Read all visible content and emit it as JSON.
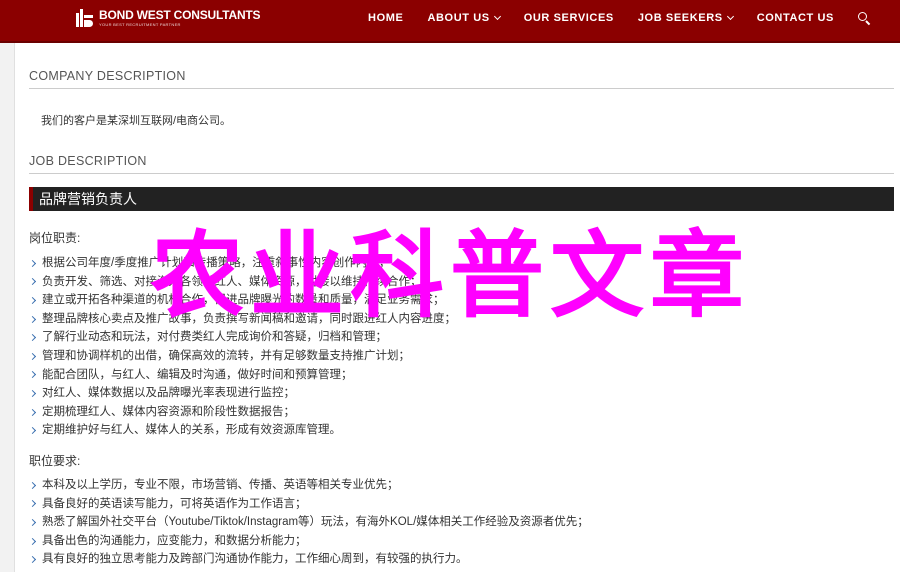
{
  "header": {
    "logo_name": "BOND WEST CONSULTANTS",
    "logo_tagline": "YOUR BEST RECRUITMENT PARTNER",
    "nav": [
      {
        "label": "HOME",
        "dropdown": false
      },
      {
        "label": "ABOUT US",
        "dropdown": true
      },
      {
        "label": "OUR SERVICES",
        "dropdown": false
      },
      {
        "label": "JOB SEEKERS",
        "dropdown": true
      },
      {
        "label": "CONTACT US",
        "dropdown": false
      }
    ],
    "search_icon": "search-icon",
    "bg_color": "#8b0000"
  },
  "company": {
    "heading": "COMPANY DESCRIPTION",
    "text": "我们的客户是某深圳互联网/电商公司。"
  },
  "job": {
    "heading": "JOB DESCRIPTION",
    "title": "品牌营销负责人",
    "duties_heading": "岗位职责:",
    "duties": [
      "根据公司年度/季度推广计划和传播策略，注重叙事性内容创作内容；",
      "负责开发、筛选、对接海外各领域红人、媒体资源，对接以维持持续合作；",
      "建立或开拓各种渠道的机构合作，促进品牌曝光的数量和质量，满足业务需求；",
      "整理品牌核心卖点及推广故事，负责撰写新闻稿和邀请，同时跟进红人内容进度；",
      "了解行业动态和玩法，对付费类红人完成询价和答疑，归档和管理；",
      "管理和协调样机的出借，确保高效的流转，并有足够数量支持推广计划；",
      "能配合团队，与红人、编辑及时沟通，做好时间和预算管理；",
      "对红人、媒体数据以及品牌曝光率表现进行监控；",
      "定期梳理红人、媒体内容资源和阶段性数据报告；",
      "定期维护好与红人、媒体人的关系，形成有效资源库管理。"
    ],
    "requirements_heading": "职位要求:",
    "requirements": [
      "本科及以上学历，专业不限，市场营销、传播、英语等相关专业优先；",
      "具备良好的英语读写能力，可将英语作为工作语言；",
      "熟悉了解国外社交平台（Youtube/Tiktok/Instagram等）玩法，有海外KOL/媒体相关工作经验及资源者优先；",
      "具备出色的沟通能力，应变能力，和数据分析能力；",
      "具有良好的独立思考能力及跨部门沟通协作能力，工作细心周到，有较强的执行力。"
    ]
  },
  "watermark": {
    "text": "农业科普文章",
    "color": "#ff00ff"
  }
}
